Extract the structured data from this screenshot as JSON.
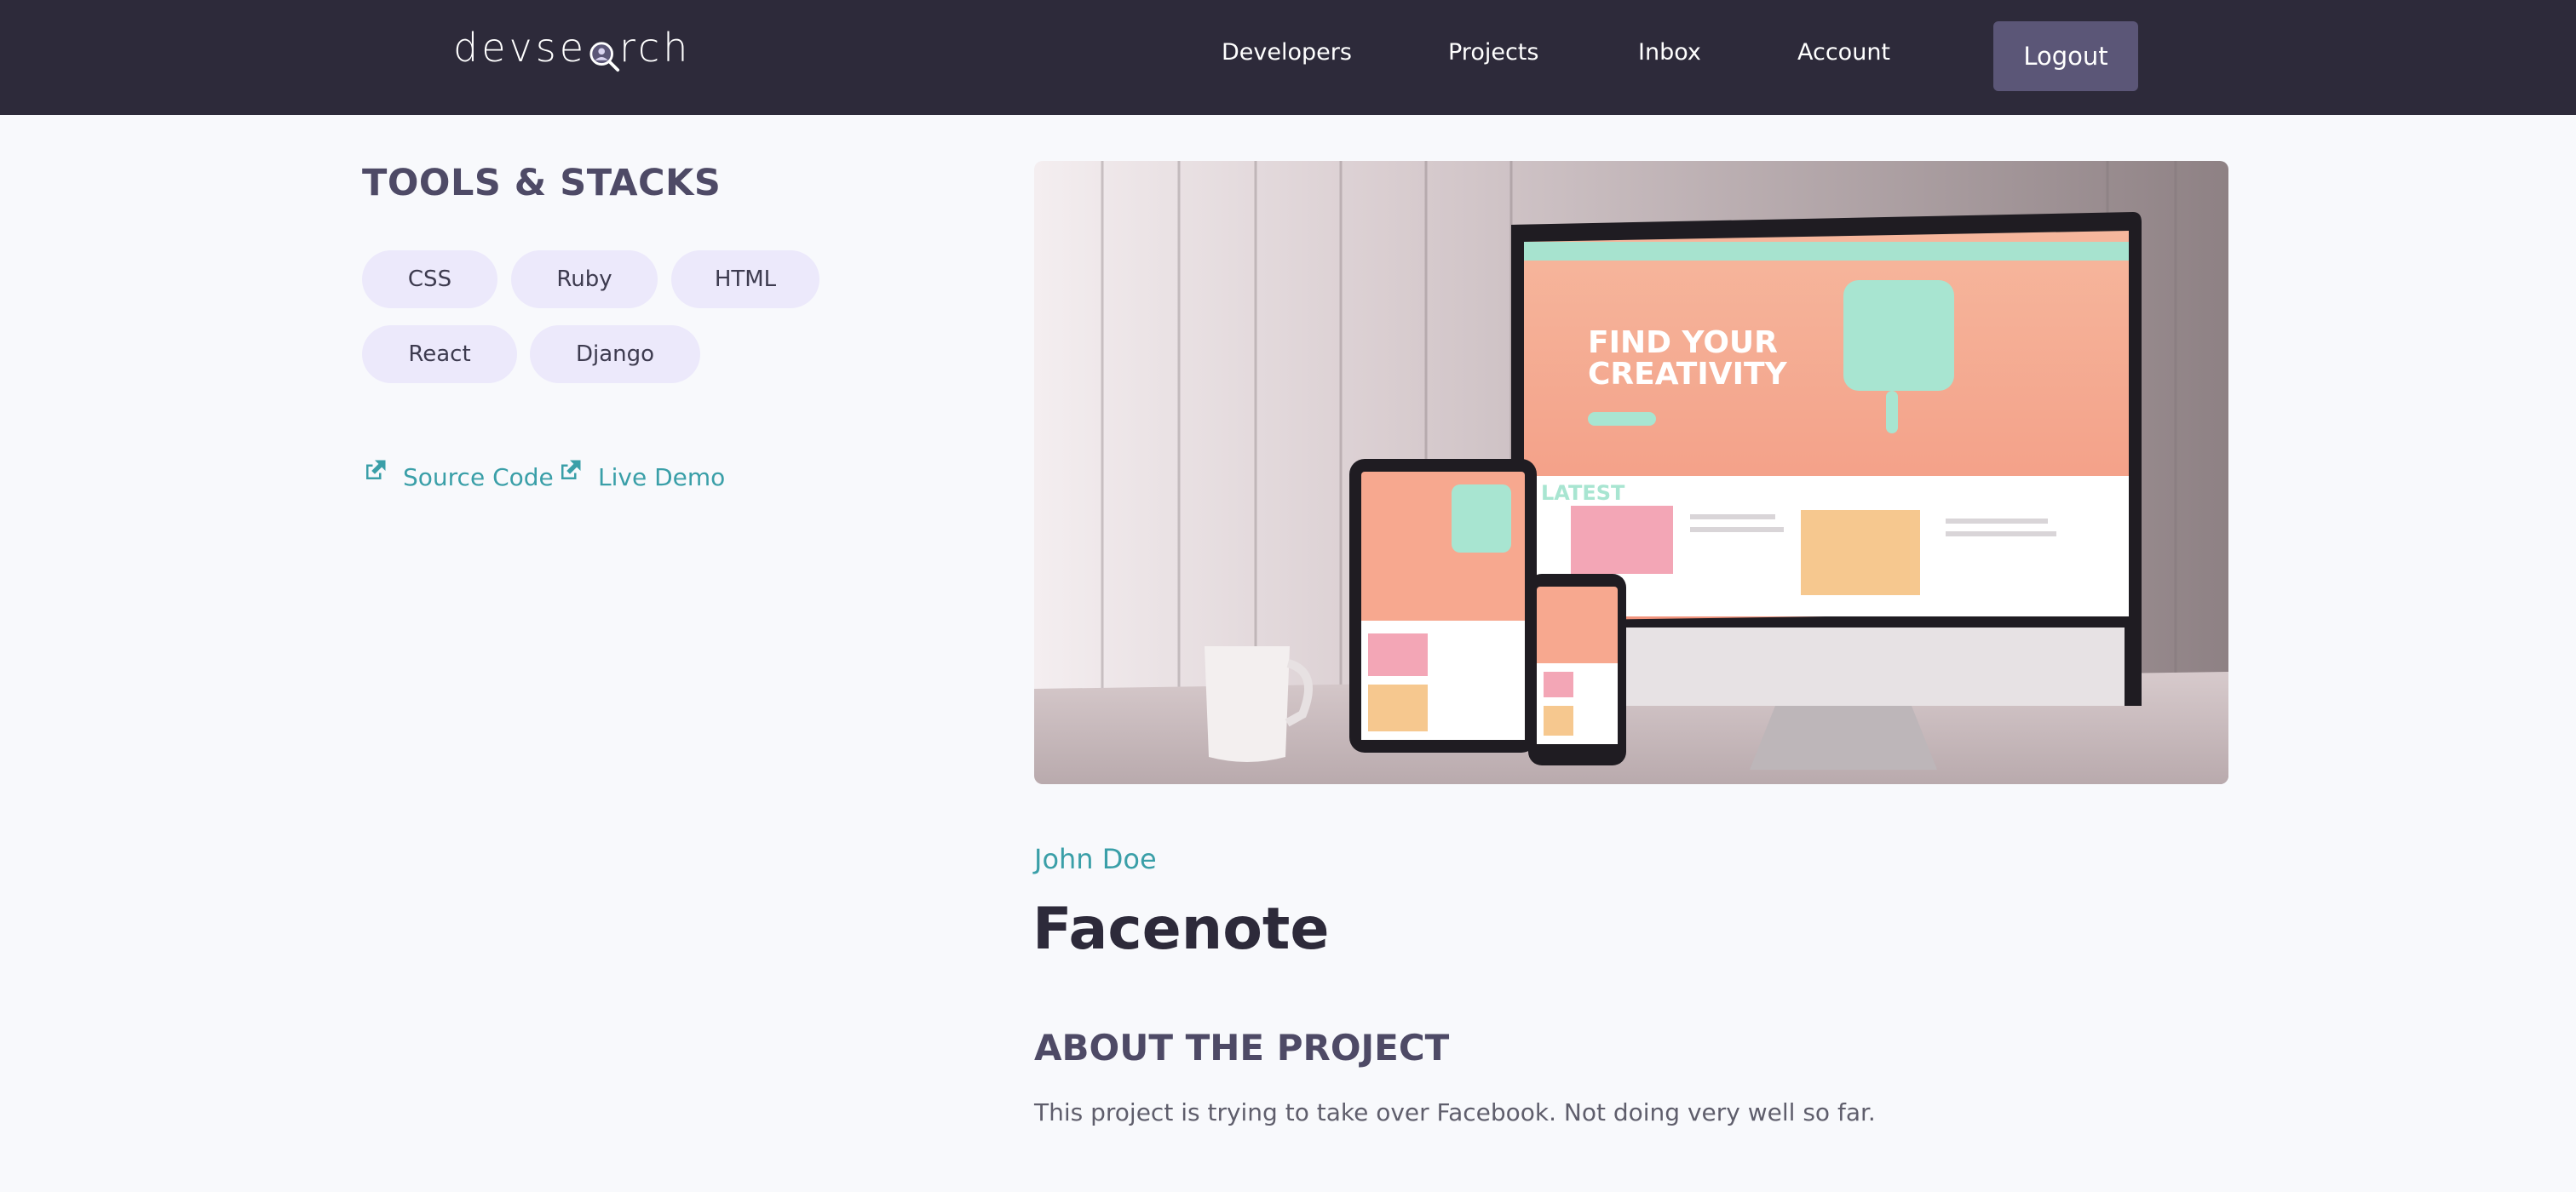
{
  "header": {
    "logo_text_left": "devse",
    "logo_text_right": "rch",
    "logo_icon": "magnifier-user-icon",
    "nav": [
      "Developers",
      "Projects",
      "Inbox",
      "Account"
    ],
    "logout_label": "Logout"
  },
  "sidebar": {
    "tools_title": "TOOLS & STACKS",
    "tags": [
      "CSS",
      "Ruby",
      "HTML",
      "React",
      "Django"
    ],
    "links": [
      {
        "label": "Source Code",
        "icon": "external-link-icon"
      },
      {
        "label": "Live Demo",
        "icon": "external-link-icon"
      }
    ]
  },
  "project": {
    "image_icon": "project-thumbnail",
    "author": "John Doe",
    "title": "Facenote",
    "about_title": "ABOUT THE PROJECT",
    "about_text": "This project is trying to take over Facebook. Not doing very well so far.",
    "mockup": {
      "headline_1": "FIND YOUR",
      "headline_2": "CREATIVITY",
      "section_label": "LATEST"
    }
  },
  "colors": {
    "header_bg": "#2d2a3a",
    "accent": "#3a9fa8",
    "tag_bg": "#ece9fb",
    "logout_bg": "#5b5677"
  }
}
